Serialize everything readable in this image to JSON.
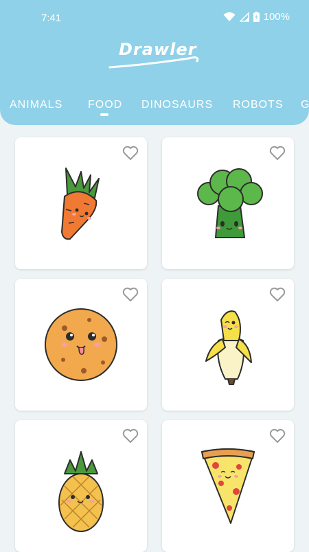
{
  "status": {
    "time": "7:41",
    "battery": "100%"
  },
  "app": {
    "title": "Drawler"
  },
  "tabs": [
    {
      "label": "ANIMALS",
      "active": false
    },
    {
      "label": "FOOD",
      "active": true
    },
    {
      "label": "DINOSAURS",
      "active": false
    },
    {
      "label": "ROBOTS",
      "active": false
    },
    {
      "label": "G",
      "active": false
    }
  ],
  "colors": {
    "header": "#8fd1e8",
    "background": "#eef3f5",
    "card": "#ffffff",
    "heart": "#9a9a9a"
  },
  "cards": [
    {
      "item": "carrot",
      "icon": "heart-outline-icon",
      "favorited": false
    },
    {
      "item": "broccoli",
      "icon": "heart-outline-icon",
      "favorited": false
    },
    {
      "item": "cookie",
      "icon": "heart-outline-icon",
      "favorited": false
    },
    {
      "item": "banana",
      "icon": "heart-outline-icon",
      "favorited": false
    },
    {
      "item": "pineapple",
      "icon": "heart-outline-icon",
      "favorited": false
    },
    {
      "item": "pizza",
      "icon": "heart-outline-icon",
      "favorited": false
    }
  ]
}
